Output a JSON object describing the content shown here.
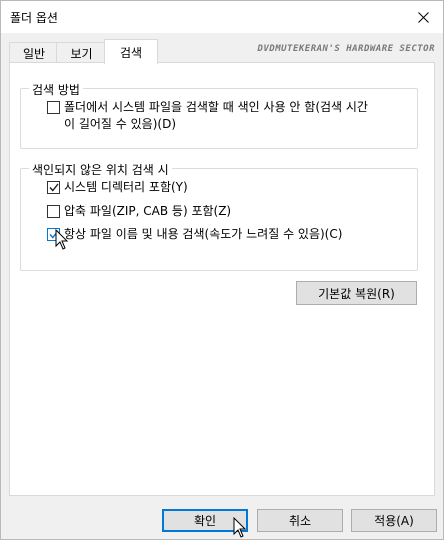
{
  "window": {
    "title": "폴더 옵션"
  },
  "tabs": [
    {
      "label": "일반"
    },
    {
      "label": "보기"
    },
    {
      "label": "검색"
    }
  ],
  "watermark": "DVDMUTEKERAN'S HARDWARE SECTOR",
  "search_group": {
    "legend": "검색 방법",
    "option_line1": "폴더에서 시스템 파일을 검색할 때 색인 사용 안 함(검색 시간",
    "option_line2": "이 길어질 수 있음)(D)",
    "option_checked": false
  },
  "nonindexed_group": {
    "legend": "색인되지 않은 위치 검색 시",
    "items": [
      {
        "label": "시스템 디렉터리 포함(Y)",
        "checked": true
      },
      {
        "label": "압축 파일(ZIP, CAB 등) 포함(Z)",
        "checked": false
      },
      {
        "label": "항상 파일 이름 및 내용 검색(속도가 느려질 수 있음)(C)",
        "checked": true
      }
    ]
  },
  "buttons": {
    "restore_defaults": "기본값 복원(R)",
    "ok": "확인",
    "cancel": "취소",
    "apply": "적용(A)"
  },
  "colors": {
    "accent": "#0078d7",
    "check": "#1e1e1e"
  }
}
